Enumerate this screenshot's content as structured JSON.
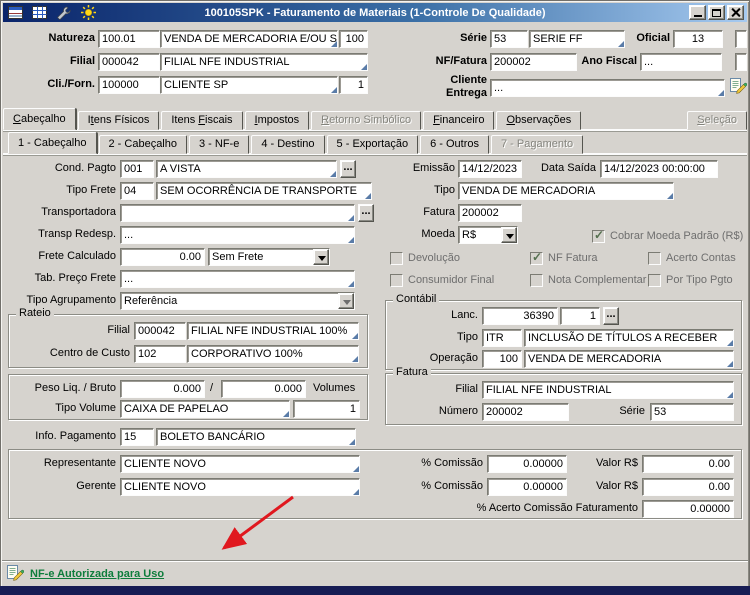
{
  "window": {
    "title": "100105SPK - Faturamento de Materiais (1-Controle De Qualidade)"
  },
  "header": {
    "natureza": {
      "label": "Natureza",
      "code": "100.01",
      "desc": "VENDA DE MERCADORIA E/OU SERVI",
      "extra": "100"
    },
    "serie": {
      "label": "Série",
      "code": "53",
      "desc": "SERIE FF"
    },
    "oficial": {
      "label": "Oficial",
      "value": "13"
    },
    "filial": {
      "label": "Filial",
      "code": "000042",
      "desc": "FILIAL NFE INDUSTRIAL"
    },
    "nf_fatura": {
      "label": "NF/Fatura",
      "value": "200002"
    },
    "ano_fiscal": {
      "label": "Ano Fiscal",
      "value": "..."
    },
    "cli_forn": {
      "label": "Cli./Forn.",
      "code": "100000",
      "desc": "CLIENTE SP",
      "extra": "1"
    },
    "cliente_entrega": {
      "label": "Cliente Entrega",
      "value": "..."
    }
  },
  "tabs_main": [
    {
      "label": "Cabeçalho",
      "underline": 0,
      "state": "active"
    },
    {
      "label": "Itens Físicos",
      "underline": 1,
      "state": "normal"
    },
    {
      "label": "Itens Fiscais",
      "underline": 6,
      "state": "normal"
    },
    {
      "label": "Impostos",
      "underline": 0,
      "state": "normal"
    },
    {
      "label": "Retorno Simbólico",
      "underline": 0,
      "state": "disabled"
    },
    {
      "label": "Financeiro",
      "underline": 0,
      "state": "normal"
    },
    {
      "label": "Observações",
      "underline": 0,
      "state": "normal"
    },
    {
      "label": "Seleção",
      "underline": 0,
      "state": "disabled"
    }
  ],
  "tabs_sub": [
    {
      "label": "1 - Cabeçalho",
      "state": "active"
    },
    {
      "label": "2 - Cabeçalho",
      "state": "normal"
    },
    {
      "label": "3 - NF-e",
      "state": "normal"
    },
    {
      "label": "4 - Destino",
      "state": "normal"
    },
    {
      "label": "5 - Exportação",
      "state": "normal"
    },
    {
      "label": "6 - Outros",
      "state": "normal"
    },
    {
      "label": "7 - Pagamento",
      "state": "disabled"
    }
  ],
  "form": {
    "browse_label": "...",
    "cond_pagto": {
      "label": "Cond. Pagto",
      "code": "001",
      "desc": "A VISTA"
    },
    "tipo_frete": {
      "label": "Tipo Frete",
      "code": "04",
      "desc": "SEM OCORRÊNCIA DE TRANSPORTE"
    },
    "transportadora": {
      "label": "Transportadora",
      "value": ""
    },
    "transp_redesp": {
      "label": "Transp Redesp.",
      "value": "..."
    },
    "frete_calculado": {
      "label": "Frete Calculado",
      "value": "0.00",
      "modalidade": "Sem Frete"
    },
    "tab_preco_frete": {
      "label": "Tab. Preço Frete",
      "value": "..."
    },
    "tipo_agrupamento": {
      "label": "Tipo Agrupamento",
      "value": "Referência"
    },
    "emissao": {
      "label": "Emissão",
      "value": "14/12/2023"
    },
    "data_saida": {
      "label": "Data Saída",
      "value": "14/12/2023 00:00:00"
    },
    "tipo": {
      "label": "Tipo",
      "value": "VENDA DE MERCADORIA"
    },
    "fatura": {
      "label": "Fatura",
      "value": "200002"
    },
    "moeda": {
      "label": "Moeda",
      "value": "R$"
    },
    "checks": {
      "cobrar_moeda": {
        "label": "Cobrar Moeda Padrão (R$)",
        "checked": true,
        "disabled": true
      },
      "devolucao": {
        "label": "Devolução",
        "checked": false,
        "disabled": true
      },
      "nf_fatura": {
        "label": "NF Fatura",
        "checked": true,
        "disabled": true
      },
      "acerto_contas": {
        "label": "Acerto Contas",
        "checked": false,
        "disabled": true
      },
      "consumidor_final": {
        "label": "Consumidor Final",
        "checked": false,
        "disabled": true
      },
      "nota_complementar": {
        "label": "Nota Complementar",
        "checked": false,
        "disabled": true
      },
      "por_tipo_pgto": {
        "label": "Por Tipo Pgto",
        "checked": false,
        "disabled": true
      }
    },
    "rateio": {
      "title": "Rateio",
      "filial_label": "Filial",
      "filial_code": "000042",
      "filial_desc": "FILIAL NFE INDUSTRIAL 100%",
      "centro_custo_label": "Centro de Custo",
      "centro_custo_code": "102",
      "centro_custo_desc": "CORPORATIVO 100%"
    },
    "contabil": {
      "title": "Contábil",
      "lanc_label": "Lanc.",
      "lanc_num": "36390",
      "lanc_seq": "1",
      "tipo_label": "Tipo",
      "tipo_code": "ITR",
      "tipo_desc": "INCLUSÃO DE TÍTULOS A RECEBER",
      "operacao_label": "Operação",
      "operacao_code": "100",
      "operacao_desc": "VENDA DE MERCADORIA"
    },
    "peso": {
      "label": "Peso Liq. / Bruto",
      "liquido": "0.000",
      "separador": "/",
      "bruto": "0.000",
      "volumes_label": "Volumes"
    },
    "tipo_volume": {
      "label": "Tipo Volume",
      "desc": "CAIXA DE PAPELAO",
      "quantidade": "1"
    },
    "fatura_grupo": {
      "title": "Fatura",
      "filial_label": "Filial",
      "filial_value": "FILIAL NFE INDUSTRIAL",
      "numero_label": "Número",
      "numero_value": "200002",
      "serie_label": "Série",
      "serie_value": "53"
    },
    "info_pagamento": {
      "label": "Info. Pagamento",
      "code": "15",
      "desc": "BOLETO BANCÁRIO"
    },
    "comissoes": {
      "representante_label": "Representante",
      "representante_value": "CLIENTE NOVO",
      "gerente_label": "Gerente",
      "gerente_value": "CLIENTE NOVO",
      "rep_pct_label": "% Comissão",
      "rep_pct": "0.00000",
      "rep_valor_label": "Valor R$",
      "rep_valor": "0.00",
      "ger_pct_label": "% Comissão",
      "ger_pct": "0.00000",
      "ger_valor_label": "Valor R$",
      "ger_valor": "0.00",
      "acerto_label": "% Acerto Comissão Faturamento",
      "acerto_value": "0.00000"
    }
  },
  "statusbar": {
    "message": "NF-e Autorizada para Uso"
  },
  "colors": {
    "titlebar_start": "#0a246a",
    "titlebar_end": "#a6caf0",
    "window_bg": "#d6d3ce",
    "status_green": "#0e7d3c",
    "annotation_red": "#e0181f"
  }
}
